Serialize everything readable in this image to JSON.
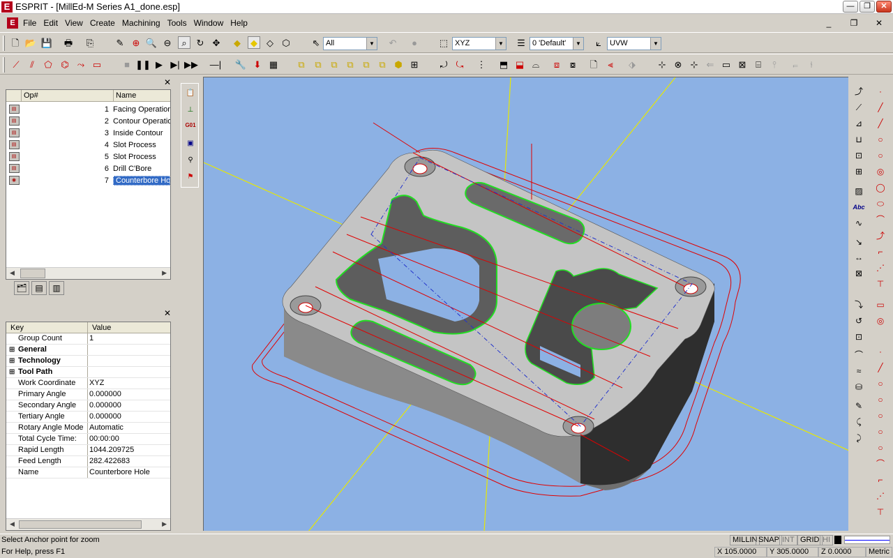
{
  "app": {
    "title": "ESPRIT - [MillEd-M Series A1_done.esp]",
    "logo_letter": "E"
  },
  "window_controls": {
    "minimize": "—",
    "maximize": "❐",
    "close": "✕"
  },
  "menu": {
    "items": [
      "File",
      "Edit",
      "View",
      "Create",
      "Machining",
      "Tools",
      "Window",
      "Help"
    ]
  },
  "mdi_controls": {
    "minimize": "_",
    "restore": "❐",
    "close": "✕"
  },
  "toolbar1": {
    "filter_select": "All",
    "plane_select": "XYZ",
    "layer_select": "0 'Default'",
    "workplane_select": "UVW"
  },
  "operations": {
    "columns": [
      "Op#",
      "Name"
    ],
    "rows": [
      {
        "num": "1",
        "name": "Facing Operation"
      },
      {
        "num": "2",
        "name": "Contour Operation"
      },
      {
        "num": "3",
        "name": "Inside Contour"
      },
      {
        "num": "4",
        "name": "Slot Process"
      },
      {
        "num": "5",
        "name": "Slot Process"
      },
      {
        "num": "6",
        "name": "Drill C'Bore"
      },
      {
        "num": "7",
        "name": "Counterbore Hole"
      }
    ],
    "selected_index": 6
  },
  "properties": {
    "columns": [
      "Key",
      "Value"
    ],
    "rows": [
      {
        "key": "Group Count",
        "value": "1",
        "group": false
      },
      {
        "key": "General",
        "value": "",
        "group": true
      },
      {
        "key": "Technology",
        "value": "",
        "group": true
      },
      {
        "key": "Tool Path",
        "value": "",
        "group": true
      },
      {
        "key": "Work Coordinate",
        "value": "XYZ",
        "group": false
      },
      {
        "key": "Primary Angle",
        "value": "0.000000",
        "group": false
      },
      {
        "key": "Secondary Angle",
        "value": "0.000000",
        "group": false
      },
      {
        "key": "Tertiary Angle",
        "value": "0.000000",
        "group": false
      },
      {
        "key": "Rotary Angle Mode",
        "value": "Automatic",
        "group": false
      },
      {
        "key": "Total Cycle Time:",
        "value": "00:00:00",
        "group": false
      },
      {
        "key": "Rapid Length",
        "value": "1044.209725",
        "group": false
      },
      {
        "key": "Feed Length",
        "value": "282.422683",
        "group": false
      },
      {
        "key": "Name",
        "value": "Counterbore Hole",
        "group": false
      }
    ]
  },
  "status": {
    "message": "Select Anchor point for zoom",
    "help": "For Help, press F1",
    "modes": [
      "MILLIN",
      "SNAP",
      "INT",
      "GRID",
      "HI"
    ],
    "x": "X 105.0000",
    "y": "Y 305.0000",
    "z": "Z 0.0000",
    "units": "Metric"
  },
  "colors": {
    "viewport_bg": "#8cb1e4",
    "part_gray": "#c0c0c0",
    "toolpath_red": "#e00000",
    "contour_green": "#22dd22",
    "axis_yellow": "#e8e800",
    "selection_blue": "#316ac5"
  }
}
